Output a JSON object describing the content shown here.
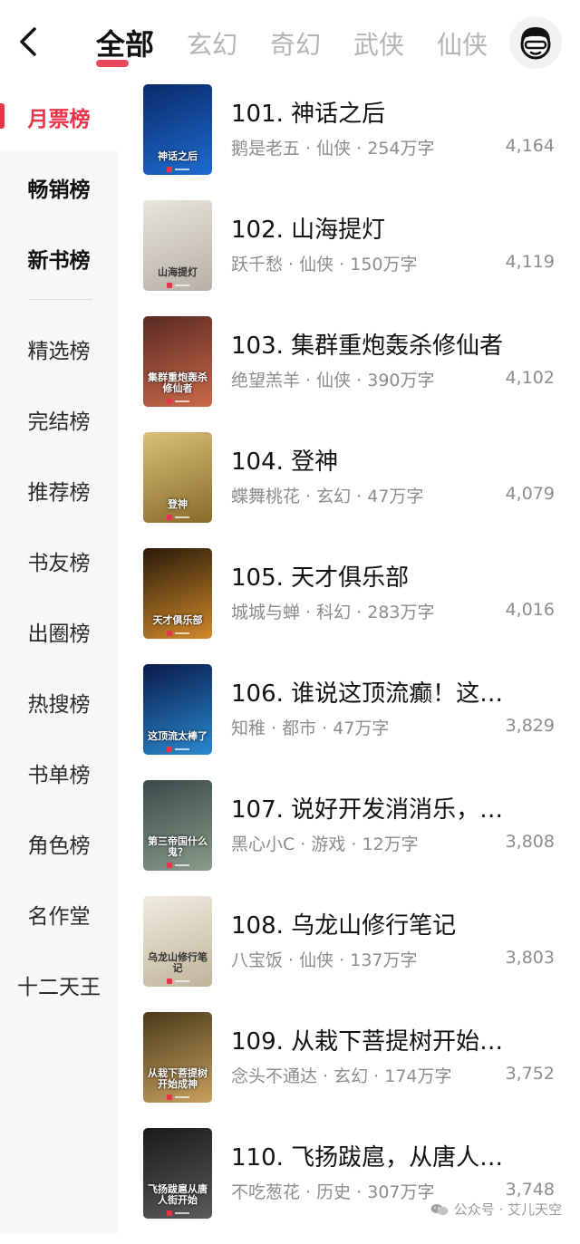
{
  "header": {
    "tabs": [
      {
        "label": "全部",
        "active": true
      },
      {
        "label": "玄幻",
        "active": false
      },
      {
        "label": "奇幻",
        "active": false
      },
      {
        "label": "武侠",
        "active": false
      },
      {
        "label": "仙侠",
        "active": false
      }
    ]
  },
  "sidebar": {
    "items": [
      {
        "label": "月票榜",
        "active": true
      },
      {
        "label": "畅销榜"
      },
      {
        "label": "新书榜"
      },
      {
        "label": "精选榜"
      },
      {
        "label": "完结榜"
      },
      {
        "label": "推荐榜"
      },
      {
        "label": "书友榜"
      },
      {
        "label": "出圈榜"
      },
      {
        "label": "热搜榜"
      },
      {
        "label": "书单榜"
      },
      {
        "label": "角色榜"
      },
      {
        "label": "名作堂"
      },
      {
        "label": "十二天王"
      }
    ]
  },
  "books": [
    {
      "title": "101. 神话之后",
      "meta": "鹅是老五 · 仙侠 · 254万字",
      "score": "4,164",
      "cover_text": "神话之后",
      "cover_colors": [
        "#0a2a6a",
        "#1e6bd0"
      ]
    },
    {
      "title": "102. 山海提灯",
      "meta": "跃千愁 · 仙侠 · 150万字",
      "score": "4,119",
      "cover_text": "山海提灯",
      "cover_colors": [
        "#e9e4dc",
        "#b7b0a6"
      ]
    },
    {
      "title": "103. 集群重炮轰杀修仙者",
      "meta": "绝望羔羊 · 仙侠 · 390万字",
      "score": "4,102",
      "cover_text": "集群重炮轰杀修仙者",
      "cover_colors": [
        "#5a2a22",
        "#c96a4a"
      ]
    },
    {
      "title": "104. 登神",
      "meta": "蝶舞桃花 · 玄幻 · 47万字",
      "score": "4,079",
      "cover_text": "登神",
      "cover_colors": [
        "#d8c07a",
        "#8a6a2a"
      ]
    },
    {
      "title": "105. 天才俱乐部",
      "meta": "城城与蝉 · 科幻 · 283万字",
      "score": "4,016",
      "cover_text": "天才俱乐部",
      "cover_colors": [
        "#2a1a0a",
        "#d08a2a"
      ]
    },
    {
      "title": "106. 谁说这顶流癫！这…",
      "meta": "知稚 · 都市 · 47万字",
      "score": "3,829",
      "cover_text": "这顶流太棒了",
      "cover_colors": [
        "#0a1a4a",
        "#2a8ad0"
      ]
    },
    {
      "title": "107. 说好开发消消乐，…",
      "meta": "黑心小C · 游戏 · 12万字",
      "score": "3,808",
      "cover_text": "第三帝国什么鬼？",
      "cover_colors": [
        "#3a4a4a",
        "#8a9a8a"
      ]
    },
    {
      "title": "108. 乌龙山修行笔记",
      "meta": "八宝饭 · 仙侠 · 137万字",
      "score": "3,803",
      "cover_text": "乌龙山修行笔记",
      "cover_colors": [
        "#f0ece0",
        "#c0b49a"
      ]
    },
    {
      "title": "109. 从栽下菩提树开始…",
      "meta": "念头不通达 · 玄幻 · 174万字",
      "score": "3,752",
      "cover_text": "从栽下菩提树开始成神",
      "cover_colors": [
        "#4a3a1a",
        "#c8a060"
      ]
    },
    {
      "title": "110. 飞扬跋扈，从唐人…",
      "meta": "不吃葱花 · 历史 · 307万字",
      "score": "3,748",
      "cover_text": "飞扬跋扈从唐人街开始",
      "cover_colors": [
        "#1a1a1a",
        "#5a5a5a"
      ]
    }
  ],
  "watermark": "公众号 · 艾儿天空",
  "colors": {
    "accent": "#e8344a",
    "muted": "#8c8c8c",
    "sidebar_bg": "#f7f7f7"
  },
  "icons": {
    "back": "chevron-left-icon",
    "avatar": "avatar-face-icon",
    "watermark": "wechat-icon"
  }
}
